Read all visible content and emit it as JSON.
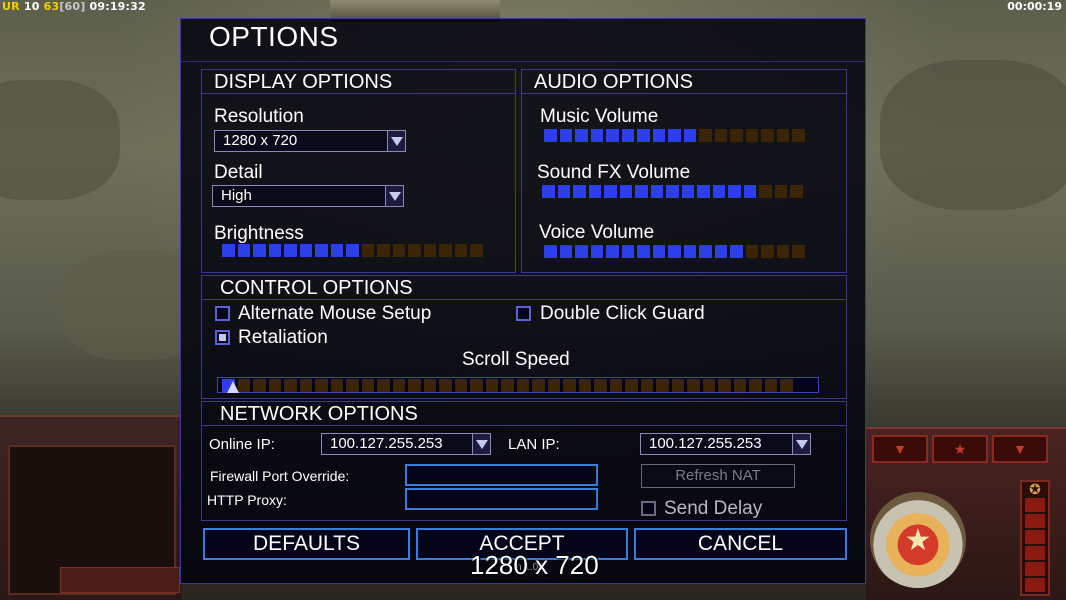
{
  "hud": {
    "top_left": {
      "prefix": "UR",
      "a": "10",
      "b": "63",
      "c": "[60]",
      "time": "09:19:32"
    },
    "top_right_time": "00:00:19",
    "tab_icons": [
      "▼",
      "★",
      "▼"
    ]
  },
  "window": {
    "title": "OPTIONS"
  },
  "display": {
    "title": "DISPLAY OPTIONS",
    "resolution_label": "Resolution",
    "resolution_value": "1280 x 720",
    "detail_label": "Detail",
    "detail_value": "High",
    "brightness_label": "Brightness",
    "brightness_level": 9,
    "brightness_max": 17
  },
  "audio": {
    "title": "AUDIO OPTIONS",
    "music_label": "Music Volume",
    "music_level": 10,
    "music_max": 17,
    "sfx_label": "Sound FX Volume",
    "sfx_level": 14,
    "sfx_max": 17,
    "voice_label": "Voice Volume",
    "voice_level": 13,
    "voice_max": 17
  },
  "control": {
    "title": "CONTROL OPTIONS",
    "alt_mouse_label": "Alternate Mouse Setup",
    "alt_mouse_checked": false,
    "double_click_label": "Double Click Guard",
    "double_click_checked": false,
    "retaliation_label": "Retaliation",
    "retaliation_checked": true,
    "scroll_label": "Scroll Speed",
    "scroll_level": 1,
    "scroll_max": 37
  },
  "network": {
    "title": "NETWORK OPTIONS",
    "online_ip_label": "Online IP:",
    "online_ip_value": "100.127.255.253",
    "lan_ip_label": "LAN IP:",
    "lan_ip_value": "100.127.255.253",
    "firewall_label": "Firewall Port Override:",
    "firewall_value": "",
    "proxy_label": "HTTP Proxy:",
    "proxy_value": "",
    "refresh_nat_label": "Refresh NAT",
    "send_delay_label": "Send Delay",
    "send_delay_checked": false
  },
  "buttons": {
    "defaults": "DEFAULTS",
    "accept": "ACCEPT",
    "cancel": "CANCEL"
  },
  "overlay": {
    "resolution_text": "1280 x 720",
    "version_text": "n 1.04"
  }
}
